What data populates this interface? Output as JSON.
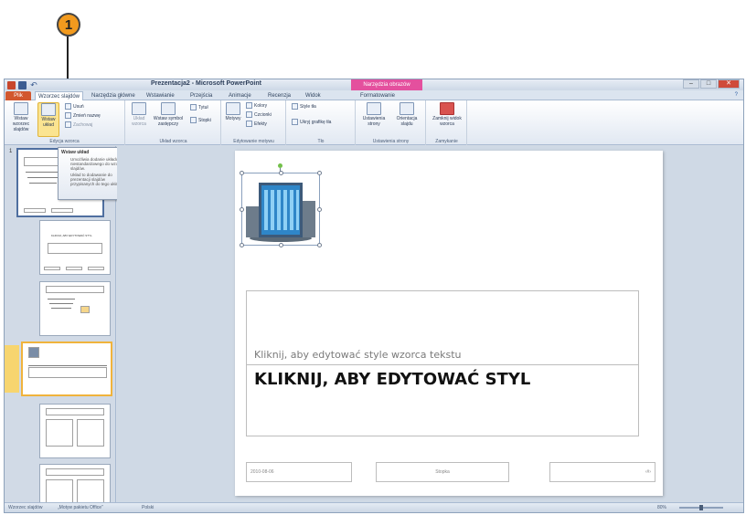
{
  "callout": {
    "number": "1"
  },
  "window": {
    "title": "Prezentacja2 - Microsoft PowerPoint",
    "context_tab": "Narzędzia obrazów"
  },
  "tabs": [
    {
      "label": "Plik"
    },
    {
      "label": "Wzorzec slajdów"
    },
    {
      "label": "Narzędzia główne"
    },
    {
      "label": "Wstawianie"
    },
    {
      "label": "Przejścia"
    },
    {
      "label": "Animacje"
    },
    {
      "label": "Recenzja"
    },
    {
      "label": "Widok"
    },
    {
      "label": "Formatowanie"
    }
  ],
  "ribbon": {
    "edit_group": {
      "label": "Edycja wzorca",
      "insert_master": "Wstaw wzorzec slajdów",
      "insert_layout": "Wstaw układ",
      "delete": "Usuń",
      "rename": "Zmień nazwę",
      "preserve": "Zachowaj"
    },
    "layout_group": {
      "label": "Układ wzorca",
      "master_layout": "Układ wzorca",
      "insert_placeholder": "Wstaw symbol zastępczy",
      "title": "Tytuł",
      "footers": "Stopki"
    },
    "theme_group": {
      "label": "Edytowanie motywu",
      "themes": "Motywy",
      "colors": "Kolory",
      "fonts": "Czcionki",
      "effects": "Efekty"
    },
    "background_group": {
      "label": "Tło",
      "bg_styles": "Style tła",
      "hide_bg": "Ukryj grafikę tła"
    },
    "page_setup_group": {
      "label": "Ustawienia strony",
      "page_setup": "Ustawienia strony",
      "orientation": "Orientacja slajdu"
    },
    "close_group": {
      "label": "Zamykanie",
      "close_master": "Zamknij widok wzorca"
    }
  },
  "tooltip": {
    "title": "Wstaw układ",
    "line1": "Umożliwia dodanie układu niestandardowego do wzorca slajdów.",
    "line2": "Układ to dodawanie do prezentacji slajdów przypisanych do tego układu."
  },
  "thumbnails": {
    "first_number": "1",
    "title_text": "KLIKNIJ, ABY EDYTOWAĆ STYL"
  },
  "slide": {
    "subtitle": "Kliknij, aby edytować style wzorca tekstu",
    "title": "KLIKNIJ, ABY EDYTOWAĆ STYL",
    "footer_date": "2010-08-06",
    "footer_center": "Stopka",
    "footer_page": "‹#›"
  },
  "statusbar": {
    "view": "Wzorzec slajdów",
    "theme": "„Motyw pakietu Office”",
    "language": "Polski",
    "zoom": "80%"
  },
  "colors": {
    "file_tab": "#d2572e",
    "context_tab": "#e4509e",
    "highlight": "#fbe491",
    "callout": "#f29a1e"
  }
}
